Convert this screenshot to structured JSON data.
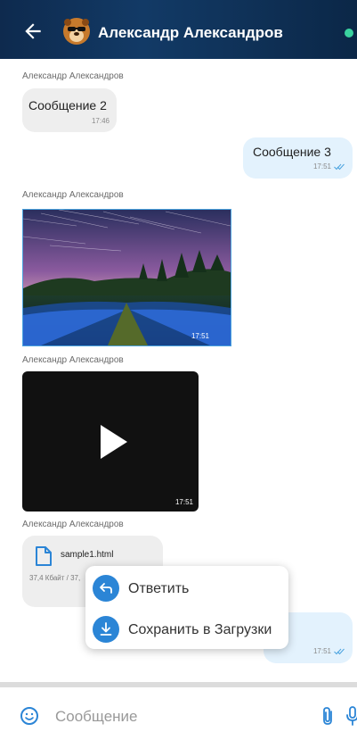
{
  "header": {
    "title": "Александр Александров",
    "status": "online"
  },
  "messages": [
    {
      "sender": "Александр Александров",
      "text": "Сообщение 2",
      "time": "17:46",
      "direction": "in"
    },
    {
      "text": "Сообщение 3",
      "time": "17:51",
      "direction": "out",
      "read": true
    },
    {
      "sender": "Александр Александров",
      "type": "photo",
      "time": "17:51",
      "direction": "in"
    },
    {
      "sender": "Александр Александров",
      "type": "video",
      "time": "17:51",
      "direction": "in"
    },
    {
      "sender": "Александр Александров",
      "type": "file",
      "file_name": "sample1.html",
      "file_size": "37,4 Кбайт / 37,",
      "direction": "in"
    },
    {
      "time": "17:51",
      "direction": "out",
      "read": true
    }
  ],
  "context_menu": {
    "items": [
      {
        "label": "Ответить",
        "icon": "reply-icon"
      },
      {
        "label": "Сохранить в Загрузки",
        "icon": "download-icon"
      }
    ]
  },
  "composer": {
    "placeholder": "Сообщение"
  },
  "colors": {
    "accent": "#2b85d6",
    "online": "#3ad29f",
    "header": "#123a66",
    "bubble_in": "#eeeeee",
    "bubble_out": "#e3f2fd"
  }
}
